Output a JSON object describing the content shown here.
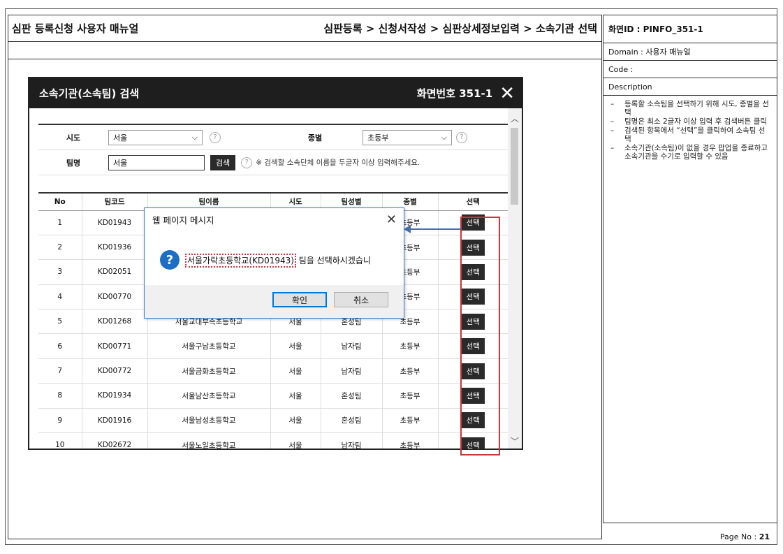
{
  "doc": {
    "title": "심판 등록신청 사용자 매뉴얼",
    "breadcrumb": "심판등록 > 신청서작성 > 심판상세정보입력 > 소속기관 선택",
    "page_no_label": "Page No :",
    "page_no": "21"
  },
  "side": {
    "screen_id": "화면ID : PINFO_351-1",
    "domain": "Domain : 사용자 매뉴얼",
    "code": "Code :",
    "description_label": "Description",
    "description": [
      "등록할 소속팀을 선택하기 위해 시도, 종별을 선택",
      "팀명은 최소 2글자 이상 입력 후 검색버튼 클릭",
      "검색된 항목에서 “선택”을 클릭하여 소속팀 선택",
      "소속기관(소속팀)이 없을 경우 팝업을 종료하고 소속기관을 수기로 입력할 수 있음"
    ]
  },
  "popup": {
    "title": "소속기관(소속팀) 검색",
    "screen_no": "화면번호 351-1",
    "close_glyph": "✕",
    "filter": {
      "sido_label": "시도",
      "sido_value": "서울",
      "type_label": "종별",
      "type_value": "초등부",
      "team_label": "팀명",
      "team_value": "서울",
      "search_label": "검색",
      "hint": "※ 검색할 소속단체 이름을 두글자 이상 입력해주세요."
    },
    "columns": [
      "No",
      "팀코드",
      "팀이름",
      "시도",
      "팀성별",
      "종별",
      "선택"
    ],
    "rows": [
      {
        "no": "1",
        "code": "KD01943",
        "name": "",
        "sido": "",
        "gender": "",
        "type": "초등부"
      },
      {
        "no": "2",
        "code": "KD01936",
        "name": "",
        "sido": "",
        "gender": "",
        "type": "초등부"
      },
      {
        "no": "3",
        "code": "KD02051",
        "name": "",
        "sido": "",
        "gender": "",
        "type": "초등부"
      },
      {
        "no": "4",
        "code": "KD00770",
        "name": "",
        "sido": "",
        "gender": "",
        "type": "초등부"
      },
      {
        "no": "5",
        "code": "KD01268",
        "name": "서울교대부속초등학교",
        "sido": "서울",
        "gender": "혼성팀",
        "type": "초등부"
      },
      {
        "no": "6",
        "code": "KD00771",
        "name": "서울구남초등학교",
        "sido": "서울",
        "gender": "남자팀",
        "type": "초등부"
      },
      {
        "no": "7",
        "code": "KD00772",
        "name": "서울금화초등학교",
        "sido": "서울",
        "gender": "남자팀",
        "type": "초등부"
      },
      {
        "no": "8",
        "code": "KD01934",
        "name": "서울남산초등학교",
        "sido": "서울",
        "gender": "혼성팀",
        "type": "초등부"
      },
      {
        "no": "9",
        "code": "KD01916",
        "name": "서울남성초등학교",
        "sido": "서울",
        "gender": "혼성팀",
        "type": "초등부"
      },
      {
        "no": "10",
        "code": "KD02672",
        "name": "서울노일초등학교",
        "sido": "서울",
        "gender": "남자팀",
        "type": "초등부"
      }
    ],
    "select_label": "선택"
  },
  "dialog": {
    "title": "웹 페이지 메시지",
    "message_highlight": "서울가락초등학교(KD01943)",
    "message_rest": " 팀을 선택하시겠습니",
    "ok": "확인",
    "cancel": "취소"
  },
  "colors": {
    "highlight": "#c8373a",
    "arrow": "#4a6ea8",
    "dialog_border": "#3b7dd8"
  }
}
